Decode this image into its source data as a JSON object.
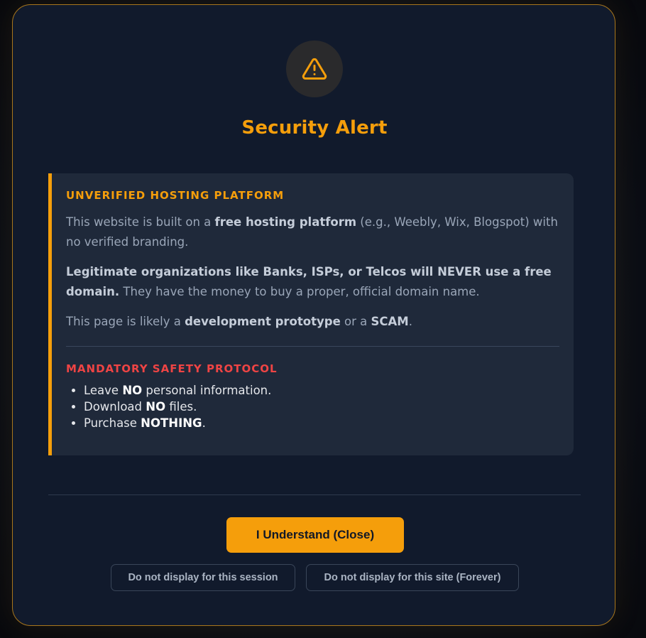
{
  "modal": {
    "icon": "warning-triangle-icon",
    "title": "Security Alert",
    "accent_color": "#f59e0b",
    "danger_color": "#ef4444"
  },
  "notice": {
    "heading": "UNVERIFIED HOSTING PLATFORM",
    "p1_pre": "This website is built on a ",
    "p1_bold": "free hosting platform",
    "p1_post": " (e.g., Weebly, Wix, Blogspot) with no verified branding.",
    "p2_bold": "Legitimate organizations like Banks, ISPs, or Telcos will NEVER use a free domain.",
    "p2_post": " They have the money to buy a proper, official domain name.",
    "p3_pre": "This page is likely a ",
    "p3_bold1": "development prototype",
    "p3_mid": " or a ",
    "p3_bold2": "SCAM",
    "p3_post": "."
  },
  "protocol": {
    "heading": "MANDATORY SAFETY PROTOCOL",
    "items": [
      {
        "pre": "Leave ",
        "bold": "NO",
        "post": " personal information."
      },
      {
        "pre": "Download ",
        "bold": "NO",
        "post": " files."
      },
      {
        "pre": "Purchase ",
        "bold": "NOTHING",
        "post": "."
      }
    ]
  },
  "actions": {
    "primary_label": "I Understand (Close)",
    "session_label": "Do not display for this session",
    "forever_label": "Do not display for this site (Forever)"
  }
}
